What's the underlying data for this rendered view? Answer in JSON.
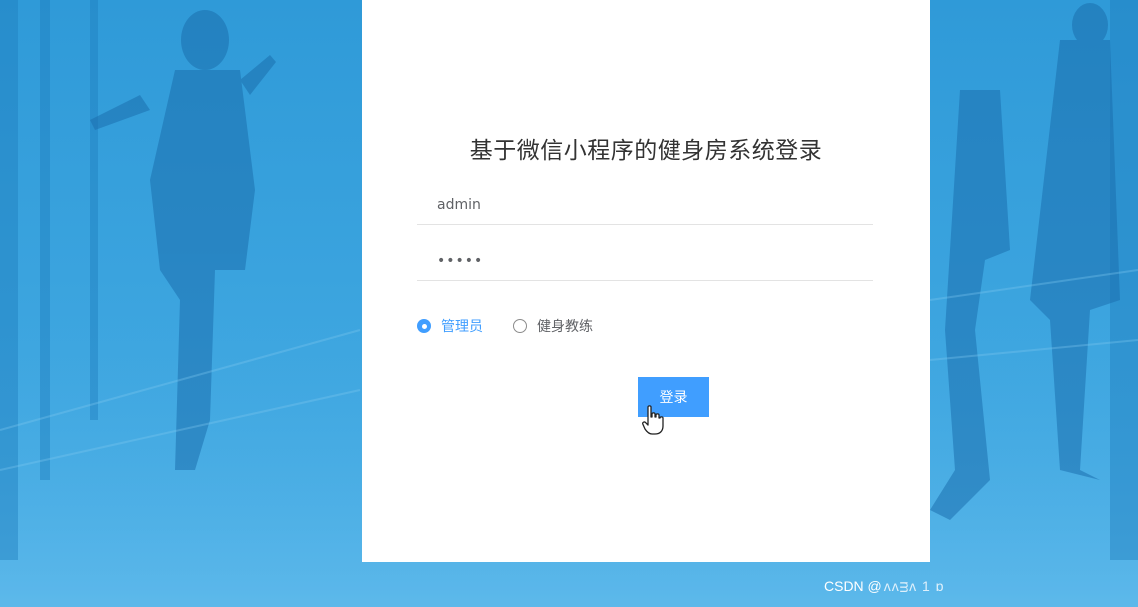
{
  "login": {
    "title": "基于微信小程序的健身房系统登录",
    "username_value": "admin",
    "password_value": "•••••",
    "roles": [
      {
        "label": "管理员",
        "selected": true
      },
      {
        "label": "健身教练",
        "selected": false
      }
    ],
    "submit_label": "登录"
  },
  "watermark": {
    "text": "CSDN @",
    "suffix": "ᴧᴧᴟᴧ 1 ɒ"
  },
  "colors": {
    "accent": "#409eff",
    "background": "#3aa3de"
  }
}
